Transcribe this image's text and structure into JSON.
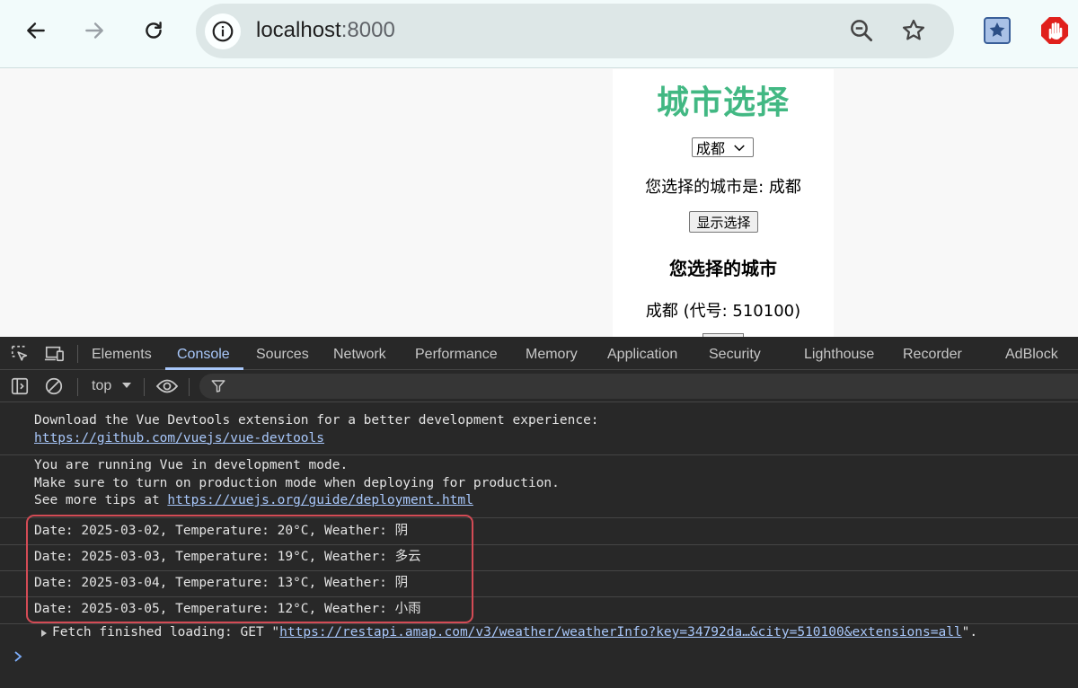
{
  "browser": {
    "url_host": "localhost",
    "url_port": ":8000"
  },
  "page": {
    "title": "城市选择",
    "select_value": "成都",
    "selected_text": "您选择的城市是: 成都",
    "show_button": "显示选择",
    "sub_heading": "您选择的城市",
    "city_code_text": "成都 (代号: 510100)"
  },
  "devtools": {
    "tabs": [
      "Elements",
      "Console",
      "Sources",
      "Network",
      "Performance",
      "Memory",
      "Application",
      "Security",
      "Lighthouse",
      "Recorder",
      "AdBlock"
    ],
    "active_tab": "Console",
    "context": "top",
    "messages": {
      "devtools_line": "Download the Vue Devtools extension for a better development experience:",
      "devtools_link": "https://github.com/vuejs/vue-devtools",
      "dev_mode_1": "You are running Vue in development mode.",
      "dev_mode_2": "Make sure to turn on production mode when deploying for production.",
      "dev_mode_3": "See more tips at ",
      "dev_mode_link": "https://vuejs.org/guide/deployment.html",
      "weather": [
        "Date: 2025-03-02, Temperature: 20°C, Weather: 阴",
        "Date: 2025-03-03, Temperature: 19°C, Weather: 多云",
        "Date: 2025-03-04, Temperature: 13°C, Weather: 阴",
        "Date: 2025-03-05, Temperature: 12°C, Weather: 小雨"
      ],
      "fetch_prefix": "Fetch finished loading: GET \"",
      "fetch_link": "https://restapi.amap.com/v3/weather/weatherInfo?key=34792da…&city=510100&extensions=all",
      "fetch_suffix": "\"."
    }
  }
}
